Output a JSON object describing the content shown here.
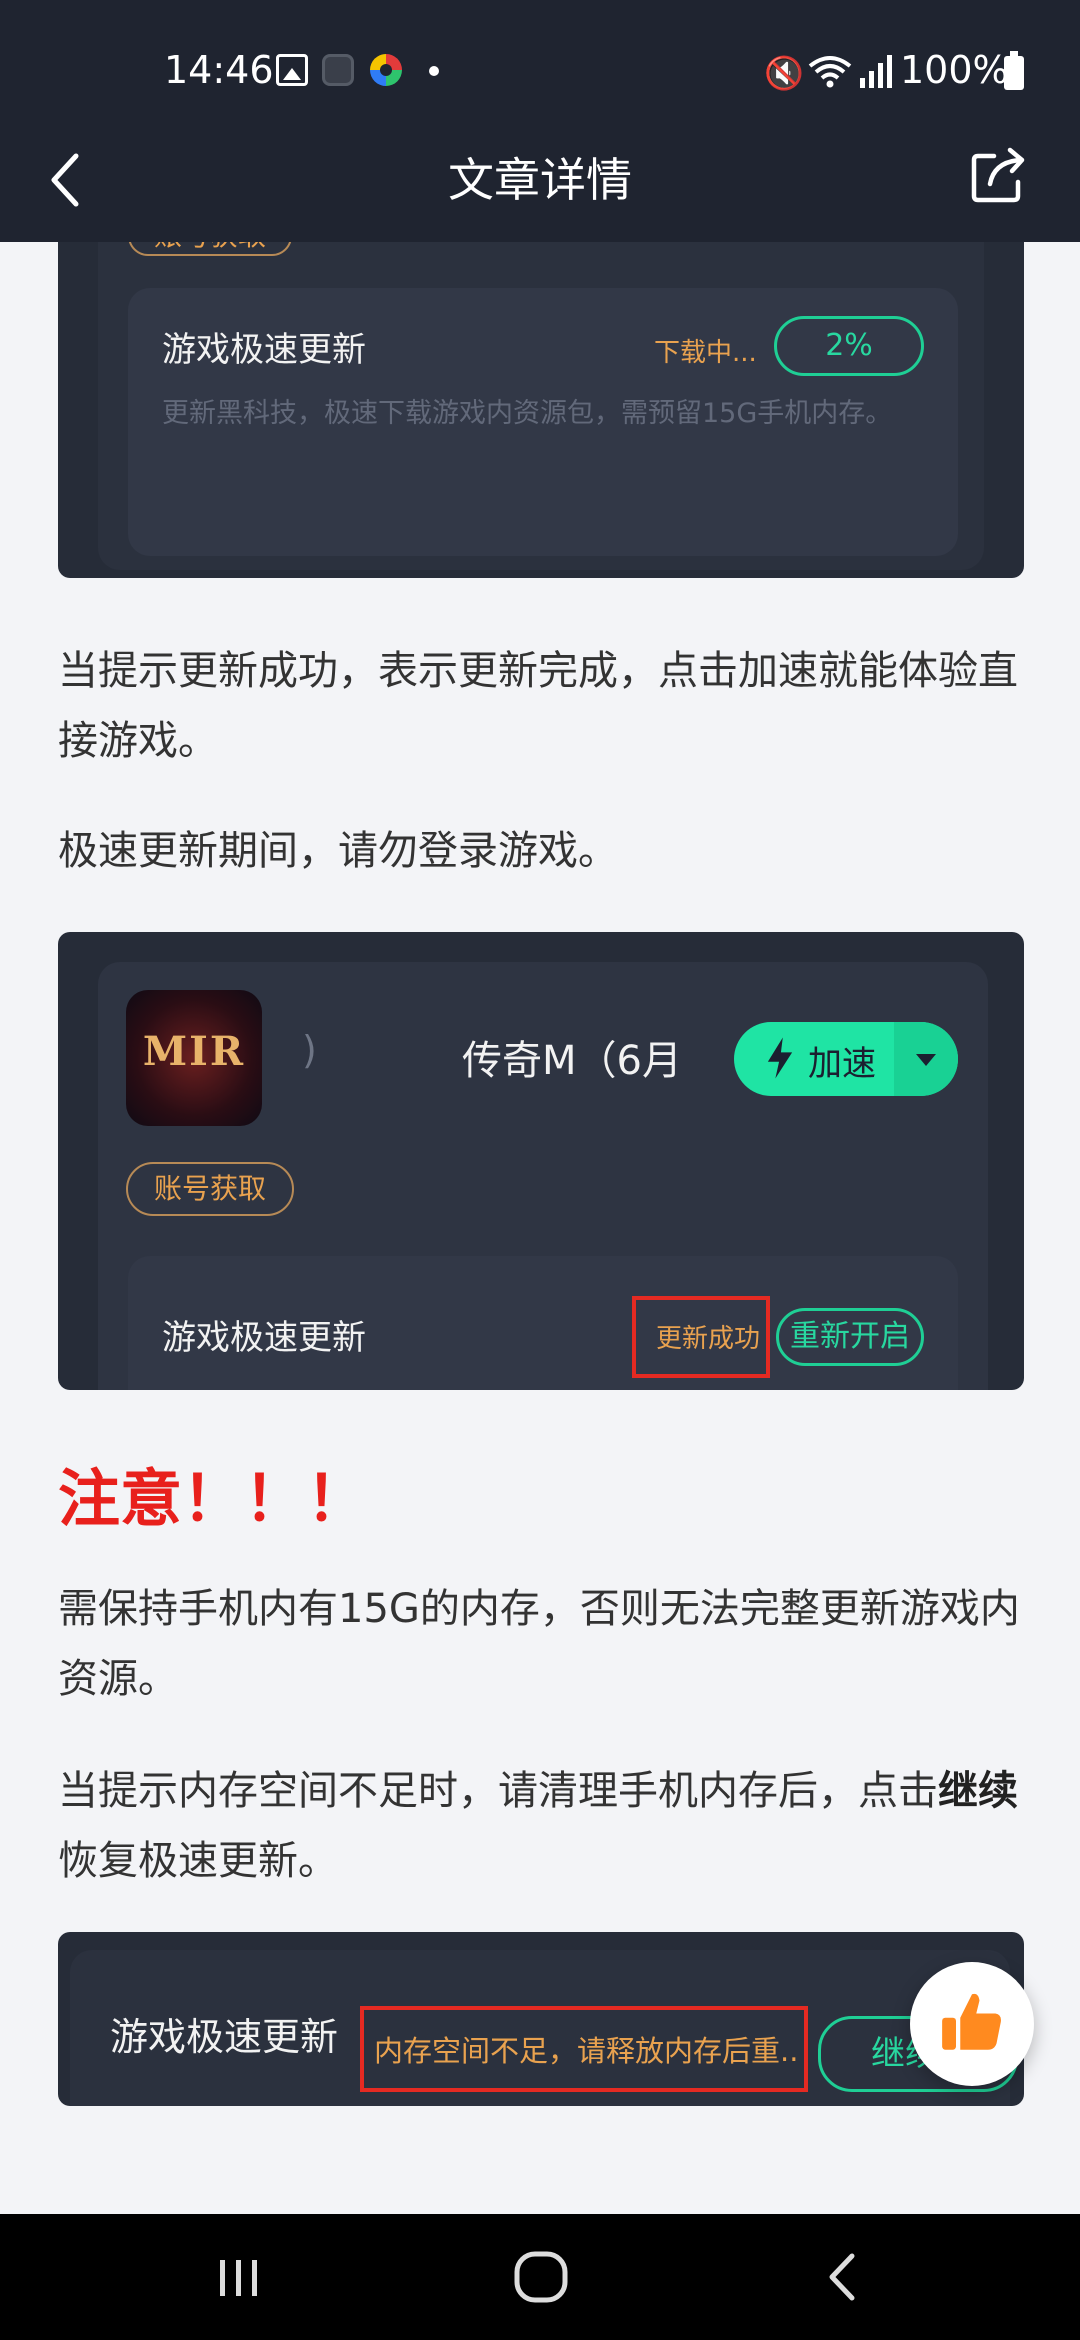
{
  "status_bar": {
    "time": "14:46",
    "battery": "100%",
    "icons": [
      "photo-icon",
      "game-icon",
      "multicolor-app-icon",
      "notification-dot",
      "mute-icon",
      "wifi-icon",
      "signal-icon",
      "battery-icon"
    ]
  },
  "header": {
    "title": "文章详情",
    "back_icon": "chevron-left-icon",
    "share_icon": "share-icon"
  },
  "shot1": {
    "tag": "账号获取",
    "feature_title": "游戏极速更新",
    "status": "下载中...",
    "progress_label": "2%",
    "progress_value": 0.02,
    "description": "更新黑科技，极速下载游戏内资源包，需预留15G手机内存。"
  },
  "para1": "当提示更新成功，表示更新完成，点击加速就能体验直接游戏。",
  "para2": "极速更新期间，请勿登录游戏。",
  "shot2": {
    "game_logo_text": "MIR",
    "paren": ")",
    "game_name": "传奇M（6月",
    "accelerate_label": "加速",
    "tag": "账号获取",
    "feature_title": "游戏极速更新",
    "status": "更新成功",
    "restart_label": "重新开启"
  },
  "notice": "注意！！！",
  "para3": "需保持手机内有15G的内存，否则无法完整更新游戏内资源。",
  "para4": {
    "bold": "继续",
    "before": "当提示内存空间不足时，请清理手机内存后，点击",
    "after": "恢复极速更新。"
  },
  "shot3": {
    "feature_title": "游戏极速更新",
    "status": "内存空间不足，请释放内存后重..",
    "continue_label": "继续"
  },
  "fab": {
    "icon": "thumbs-up-icon"
  },
  "nav": {
    "icons": [
      "recent-apps-icon",
      "home-icon",
      "back-icon"
    ]
  },
  "colors": {
    "accent": "#1fe4a4",
    "warning": "#e8201c",
    "dark_bg": "#1f2430"
  }
}
